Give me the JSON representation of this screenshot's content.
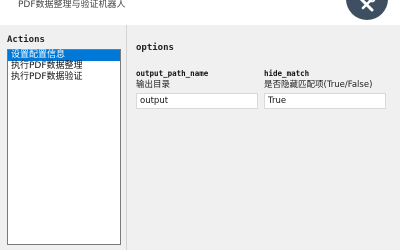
{
  "app": {
    "title": "PDF数据整理与验证机器人"
  },
  "header": {
    "tool_icon": "wrench-screwdriver-icon",
    "badge_color": "#3d4f60"
  },
  "actions": {
    "heading": "Actions",
    "items": [
      {
        "label": "设置配置信息",
        "selected": true
      },
      {
        "label": "执行PDF数据整理",
        "selected": false
      },
      {
        "label": "执行PDF数据验证",
        "selected": false
      }
    ]
  },
  "options": {
    "heading": "options",
    "fields": [
      {
        "key": "output_path_name",
        "description": "输出目录",
        "value": "output"
      },
      {
        "key": "hide_match",
        "description": "是否隐藏匹配项(True/False)",
        "value": "True"
      }
    ]
  },
  "colors": {
    "selection": "#0078d7",
    "panel_background": "#f0f0f0"
  }
}
